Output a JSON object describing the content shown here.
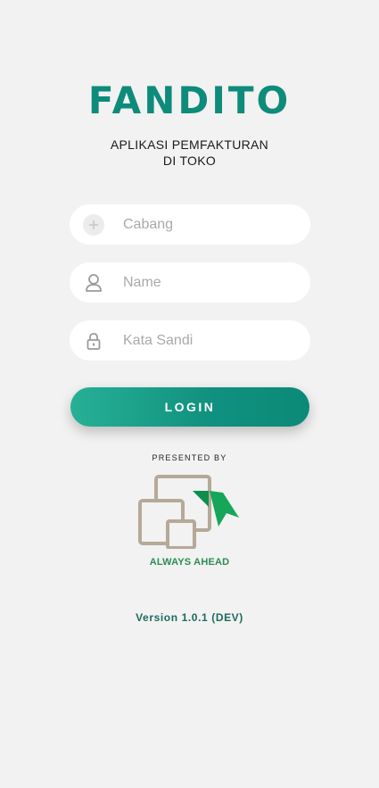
{
  "app": {
    "brand": "FANDITO",
    "subtitle_line1": "APLIKASI PEMFAKTURAN",
    "subtitle_line2": "DI TOKO",
    "brand_color": "#0e8b7b"
  },
  "form": {
    "branch": {
      "placeholder": "Cabang",
      "value": "",
      "icon": "plus-circle-icon"
    },
    "name": {
      "placeholder": "Name",
      "value": "",
      "icon": "user-icon"
    },
    "password": {
      "placeholder": "Kata Sandi",
      "value": "",
      "icon": "lock-icon"
    },
    "login_label": "LOGIN",
    "button_gradient": [
      "#27b096",
      "#0a8a77"
    ]
  },
  "footer": {
    "presented_by": "PRESENTED BY",
    "tagline": "ALWAYS AHEAD",
    "version": "Version 1.0.1 (DEV)",
    "logo_icon": "always-ahead-logo-icon"
  }
}
